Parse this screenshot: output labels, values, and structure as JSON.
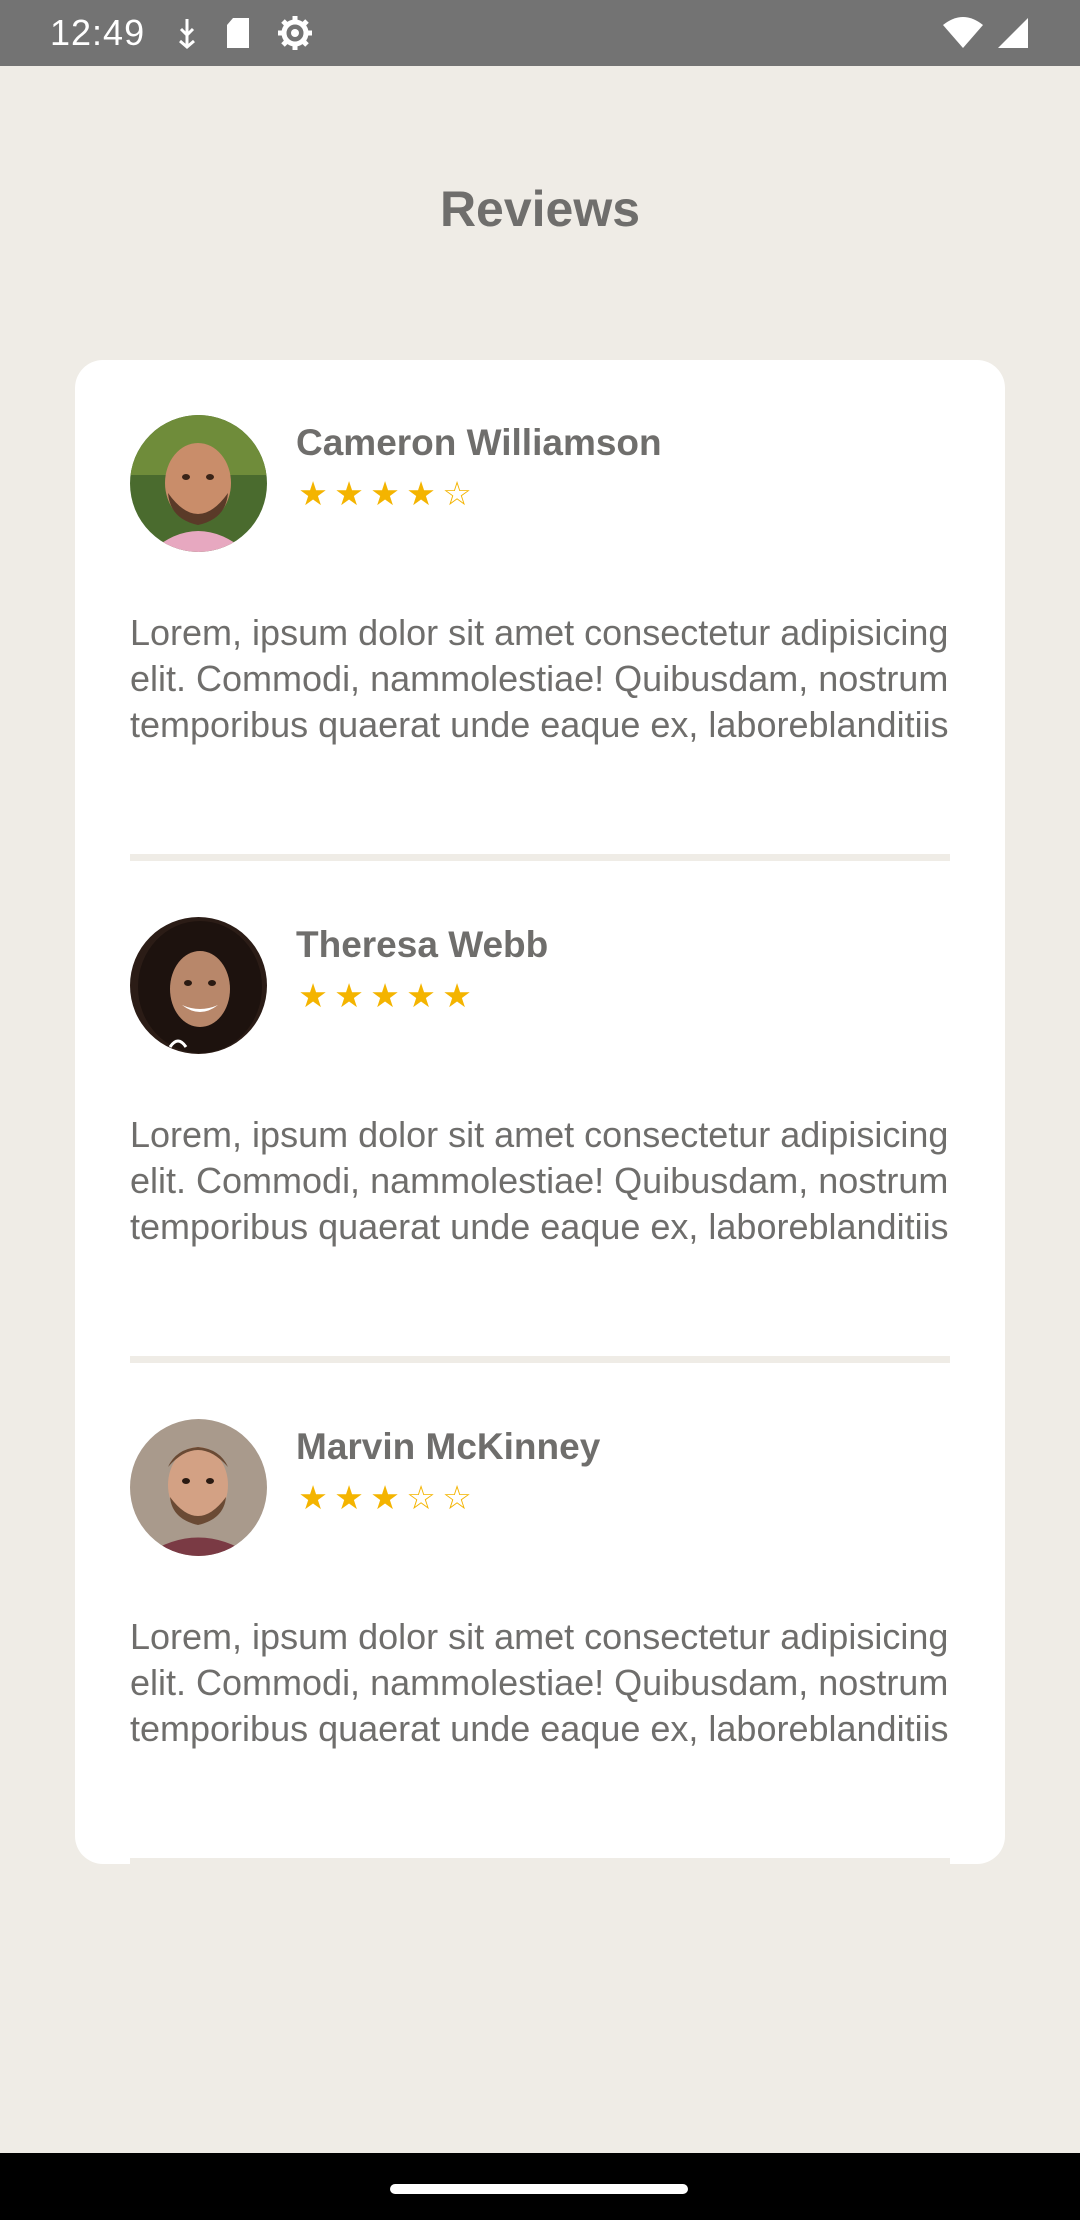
{
  "status_bar": {
    "time": "12:49",
    "icons_left": [
      "usb-debug-icon",
      "sd-card-icon",
      "settings-gear-icon"
    ],
    "icons_right": [
      "wifi-icon",
      "signal-icon"
    ]
  },
  "page": {
    "title": "Reviews"
  },
  "reviews": [
    {
      "name": "Cameron Williamson",
      "rating": 4,
      "stars": "★★★★☆",
      "avatar": "avatar-photo",
      "text": "Lorem, ipsum dolor sit amet consectetur adipisicing elit. Commodi, nammolestiae! Quibusdam, nostrum temporibus quaerat unde eaque ex, laboreblanditiis"
    },
    {
      "name": "Theresa Webb",
      "rating": 5,
      "stars": "★★★★★",
      "avatar": "avatar-photo",
      "text": "Lorem, ipsum dolor sit amet consectetur adipisicing elit. Commodi, nammolestiae! Quibusdam, nostrum temporibus quaerat unde eaque ex, laboreblanditiis"
    },
    {
      "name": "Marvin McKinney",
      "rating": 3,
      "stars": "★★★☆☆",
      "avatar": "avatar-photo",
      "text": "Lorem, ipsum dolor sit amet consectetur adipisicing elit. Commodi, nammolestiae! Quibusdam, nostrum temporibus quaerat unde eaque ex, laboreblanditiis"
    }
  ],
  "colors": {
    "background": "#efece6",
    "card": "#ffffff",
    "text": "#6f6e6c",
    "star": "#f4b400",
    "status_bar": "#737373"
  }
}
